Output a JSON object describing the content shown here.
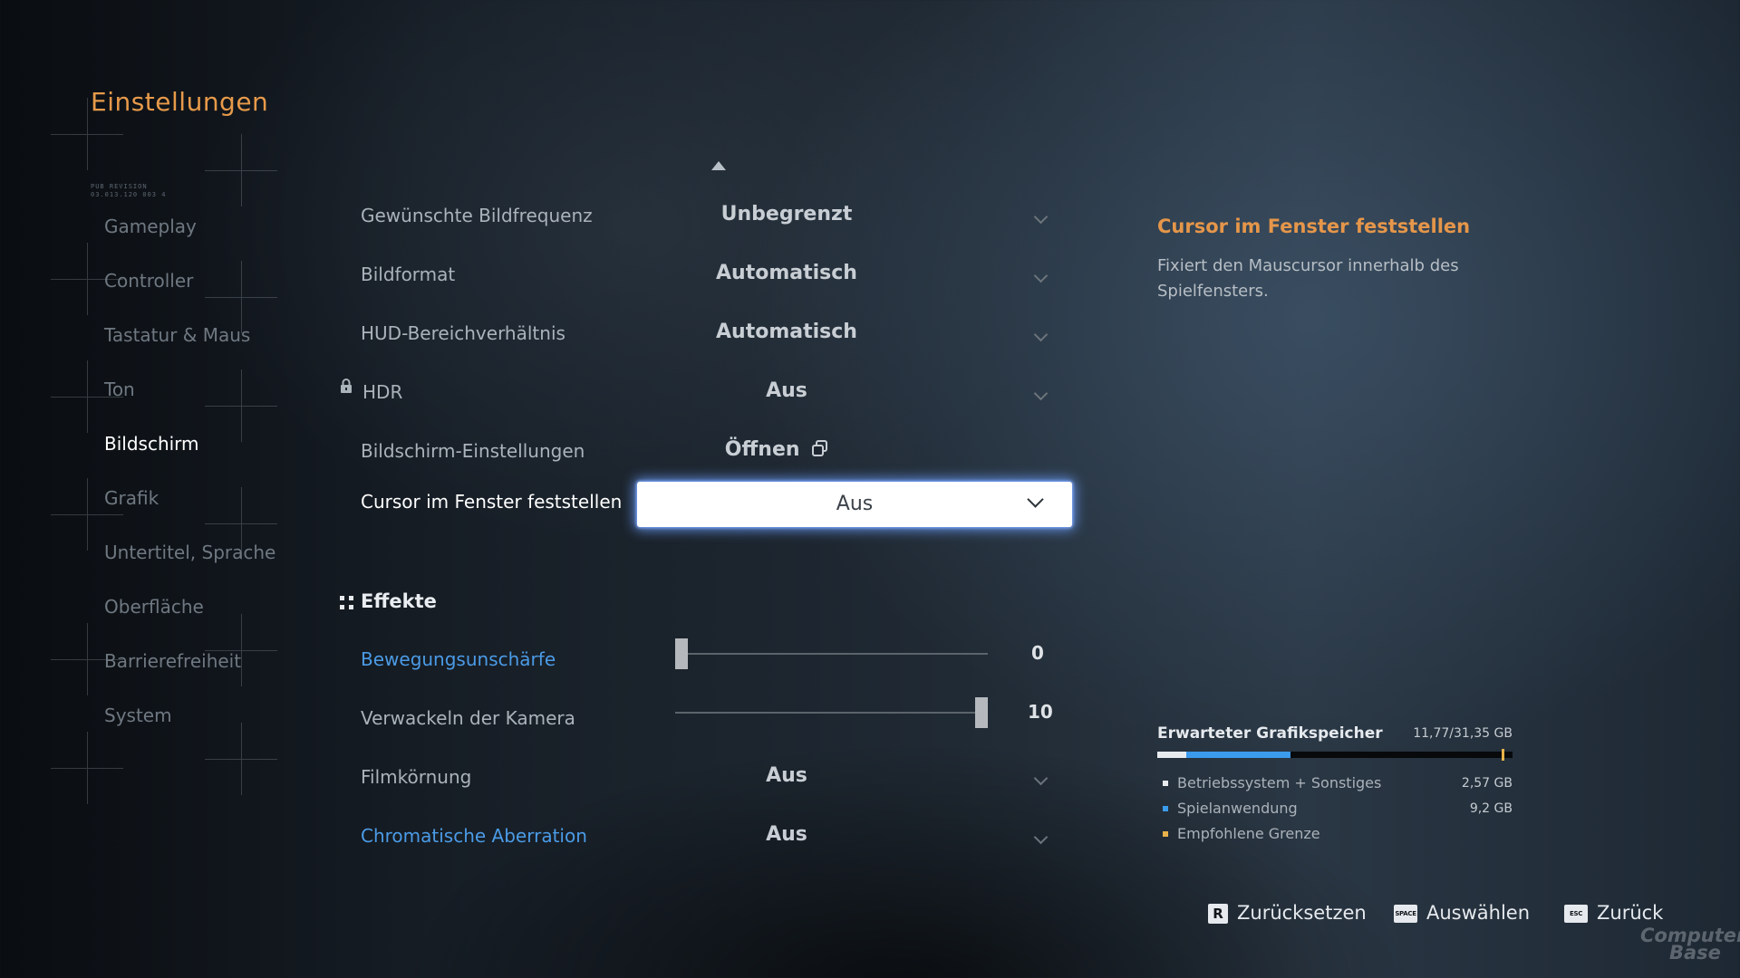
{
  "header": {
    "title": "Einstellungen"
  },
  "sidebar": {
    "caption_line1": "PUB REVISION",
    "caption_line2": "03.013.120 003 4",
    "items": [
      {
        "label": "Gameplay",
        "active": false
      },
      {
        "label": "Controller",
        "active": false
      },
      {
        "label": "Tastatur & Maus",
        "active": false
      },
      {
        "label": "Ton",
        "active": false
      },
      {
        "label": "Bildschirm",
        "active": true
      },
      {
        "label": "Grafik",
        "active": false
      },
      {
        "label": "Untertitel, Sprache",
        "active": false
      },
      {
        "label": "Oberfläche",
        "active": false
      },
      {
        "label": "Barrierefreiheit",
        "active": false
      },
      {
        "label": "System",
        "active": false
      }
    ]
  },
  "settings": {
    "frame_rate": {
      "label": "Gewünschte Bildfrequenz",
      "value": "Unbegrenzt"
    },
    "aspect": {
      "label": "Bildformat",
      "value": "Automatisch"
    },
    "hud_ratio": {
      "label": "HUD-Bereichverhältnis",
      "value": "Automatisch"
    },
    "hdr": {
      "label": "HDR",
      "value": "Aus",
      "icon": "lock-icon"
    },
    "display_settings": {
      "label": "Bildschirm-Einstellungen",
      "value": "Öffnen",
      "icon": "external-window-icon"
    },
    "cursor_lock": {
      "label": "Cursor im Fenster feststellen",
      "value": "Aus"
    }
  },
  "effects": {
    "section_label": "Effekte",
    "motion_blur": {
      "label": "Bewegungsunschärfe",
      "value": 0,
      "min": 0,
      "max": 10,
      "display": "0"
    },
    "camera_shake": {
      "label": "Verwackeln der Kamera",
      "value": 10,
      "min": 0,
      "max": 10,
      "display": "10"
    },
    "film_grain": {
      "label": "Filmkörnung",
      "value": "Aus"
    },
    "chromatic": {
      "label": "Chromatische Aberration",
      "value": "Aus"
    }
  },
  "info": {
    "title": "Cursor im Fenster feststellen",
    "description": "Fixiert den Mauscursor innerhalb des Spielfensters."
  },
  "memory": {
    "title": "Erwarteter Grafikspeicher",
    "total": "11,77/31,35 GB",
    "total_gb": 31.35,
    "os_gb": 2.57,
    "app_gb": 9.2,
    "limit_gb": 30.4,
    "legend": [
      {
        "label": "Betriebssystem + Sonstiges",
        "value": "2,57 GB",
        "color": "#e8ecef"
      },
      {
        "label": "Spielanwendung",
        "value": "9,2 GB",
        "color": "#3b9bed"
      },
      {
        "label": "Empfohlene Grenze",
        "value": "",
        "color": "#e7b24a"
      }
    ]
  },
  "footer": {
    "reset": {
      "key": "R",
      "label": "Zurücksetzen"
    },
    "select": {
      "key": "SPACE",
      "label": "Auswählen"
    },
    "back": {
      "key": "ESC",
      "label": "Zurück"
    }
  },
  "watermark": {
    "line1": "Computer",
    "line2": "Base"
  },
  "colors": {
    "accent": "#e5964a",
    "highlight": "#4b9be6",
    "focus_glow": "#6ea0ff"
  }
}
